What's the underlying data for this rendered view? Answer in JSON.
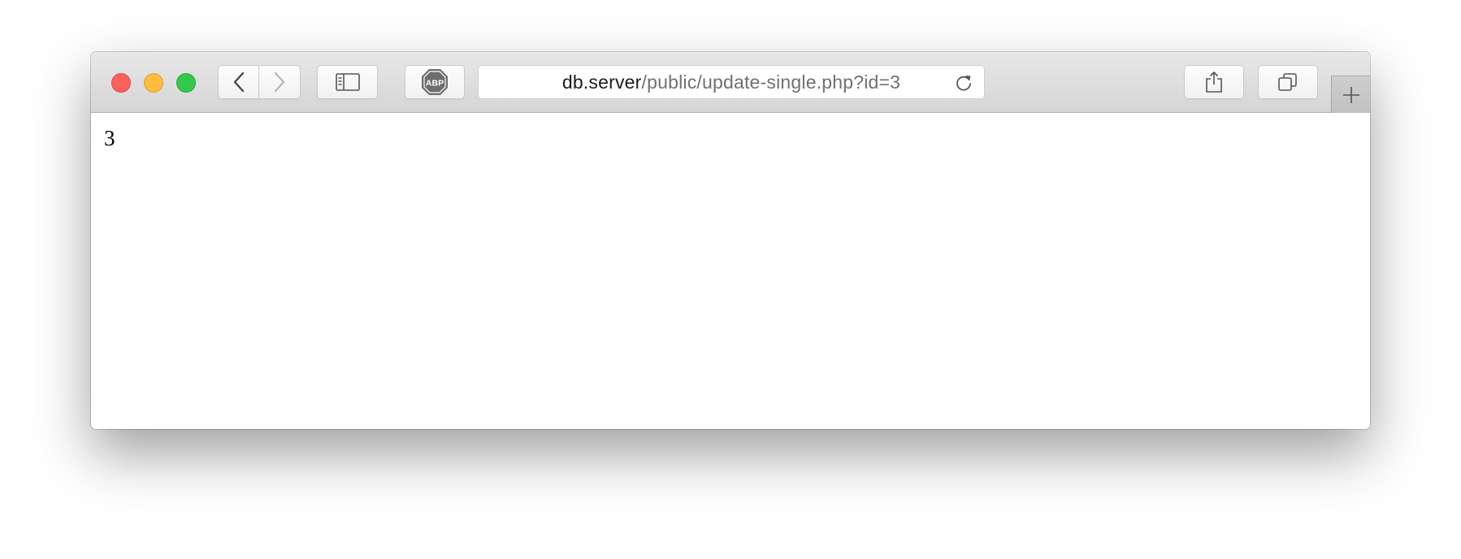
{
  "browser": {
    "address_bar": {
      "host": "db.server",
      "path": "/public/update-single.php?id=3"
    },
    "icons": {
      "back": "chevron-left-icon",
      "forward": "chevron-right-icon",
      "sidebar": "sidebar-icon",
      "adblock": "abp-icon",
      "reload": "reload-icon",
      "share": "share-icon",
      "tabs": "tabs-overview-icon",
      "new_tab": "plus-icon"
    },
    "adblock_label": "ABP",
    "colors": {
      "close": "#fc605c",
      "minimize": "#fdbc40",
      "maximize": "#34c84a"
    }
  },
  "page": {
    "body_text": "3"
  }
}
